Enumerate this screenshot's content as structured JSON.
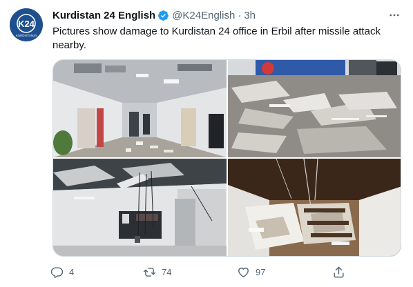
{
  "tweet": {
    "author": {
      "display_name": "Kurdistan 24 English",
      "handle": "@K24English",
      "verified": true,
      "avatar_icon": "k24-logo",
      "avatar_text": "K24",
      "avatar_subtext": "KURDISTAN24"
    },
    "separator": "·",
    "time": "3h",
    "text": "Pictures show damage to Kurdistan 24 office in Erbil after missile attack nearby.",
    "media": [
      {
        "icon": "photo-office-corridor-debris"
      },
      {
        "icon": "photo-fallen-ceiling-tiles-floor"
      },
      {
        "icon": "photo-damaged-ceiling-room"
      },
      {
        "icon": "photo-collapsed-stairwell"
      }
    ],
    "actions": {
      "reply": {
        "icon": "reply-icon",
        "count": "4"
      },
      "retweet": {
        "icon": "retweet-icon",
        "count": "74"
      },
      "like": {
        "icon": "heart-icon",
        "count": "97"
      },
      "share": {
        "icon": "share-icon"
      }
    },
    "colors": {
      "verified_badge": "#1d9bf0",
      "secondary_text": "#536471",
      "avatar_bg": "#1e4f8e"
    }
  }
}
